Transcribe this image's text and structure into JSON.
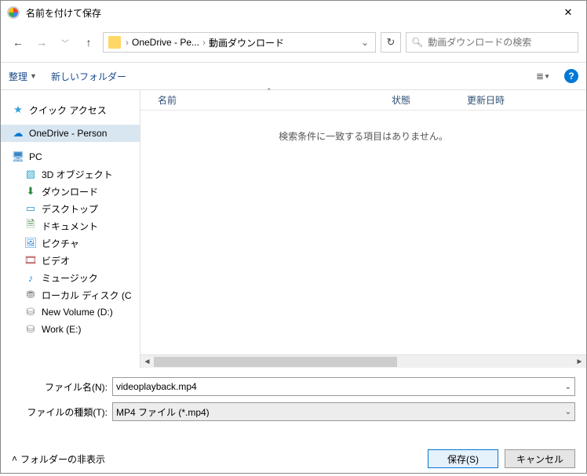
{
  "title": "名前を付けて保存",
  "breadcrumb": {
    "p1": "OneDrive - Pe...",
    "p2": "動画ダウンロード"
  },
  "search": {
    "placeholder": "動画ダウンロードの検索"
  },
  "toolbar": {
    "organize": "整理",
    "newfolder": "新しいフォルダー",
    "help": "?"
  },
  "tree": {
    "quick": "クイック アクセス",
    "onedrive": "OneDrive - Person",
    "pc": "PC",
    "threed": "3D オブジェクト",
    "downloads": "ダウンロード",
    "desktop": "デスクトップ",
    "documents": "ドキュメント",
    "pictures": "ピクチャ",
    "videos": "ビデオ",
    "music": "ミュージック",
    "localdisk": "ローカル ディスク (C",
    "newvol": "New Volume (D:)",
    "work": "Work (E:)"
  },
  "cols": {
    "name": "名前",
    "state": "状態",
    "modified": "更新日時"
  },
  "empty": "検索条件に一致する項目はありません。",
  "form": {
    "name_label": "ファイル名(N):",
    "name_value": "videoplayback.mp4",
    "type_label": "ファイルの種類(T):",
    "type_value": "MP4 ファイル (*.mp4)"
  },
  "footer": {
    "hide": "フォルダーの非表示",
    "save": "保存(S)",
    "cancel": "キャンセル"
  }
}
